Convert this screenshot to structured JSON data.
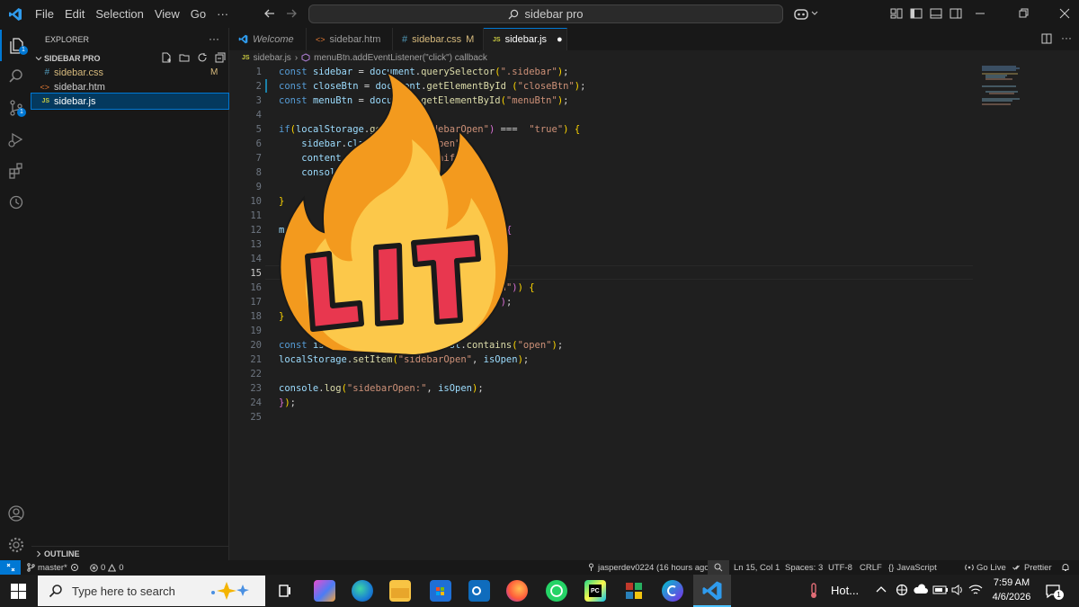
{
  "titlebar": {
    "menus": [
      "File",
      "Edit",
      "Selection",
      "View",
      "Go",
      "···"
    ],
    "search_text": "sidebar pro"
  },
  "explorer": {
    "header": "EXPLORER",
    "folder": "SIDEBAR PRO",
    "files": [
      {
        "name": "sidebar.css",
        "badge": "M",
        "type": "#",
        "color": "#519aba"
      },
      {
        "name": "sidebar.htm",
        "badge": "",
        "type": "<>",
        "color": "#e37933"
      },
      {
        "name": "sidebar.js",
        "badge": "",
        "type": "JS",
        "color": "#cbcb41"
      }
    ],
    "outline": "OUTLINE"
  },
  "tabs": [
    {
      "label": "Welcome",
      "icon": "vscode-icon",
      "badge": ""
    },
    {
      "label": "sidebar.htm",
      "icon": "<>",
      "badge": ""
    },
    {
      "label": "sidebar.css",
      "icon": "#",
      "badge": "M"
    },
    {
      "label": "sidebar.js",
      "icon": "JS",
      "badge": "●"
    }
  ],
  "breadcrumb": {
    "file": "sidebar.js",
    "symbol": "menuBtn.addEventListener(\"click\") callback"
  },
  "editor": {
    "current_line": 15,
    "line_numbers": [
      "1",
      "2",
      "3",
      "4",
      "5",
      "6",
      "7",
      "8",
      "9",
      "10",
      "11",
      "12",
      "13",
      "14",
      "15",
      "16",
      "17",
      "18",
      "19",
      "20",
      "21",
      "22",
      "23",
      "24",
      "25"
    ]
  },
  "sticker": {
    "text": "LIT"
  },
  "statusbar": {
    "branch": "master*",
    "problems": "0",
    "warnings": "0",
    "blame": "jasperdev0224 (16 hours ago)",
    "position": "Ln 15, Col 1",
    "spaces": "Spaces: 3",
    "encoding": "UTF-8",
    "eol": "CRLF",
    "language": "JavaScript",
    "golive": "Go Live",
    "prettier": "Prettier"
  },
  "taskbar": {
    "search_placeholder": "Type here to search",
    "weather": "Hot...",
    "time": "7:59 AM",
    "date": "4/6/2026",
    "notifications": "1"
  },
  "colors": {
    "accent": "#0078d4",
    "sticker_flame": "#f39a1e",
    "sticker_inner": "#fcc84a",
    "sticker_letters": "#e8374f"
  }
}
